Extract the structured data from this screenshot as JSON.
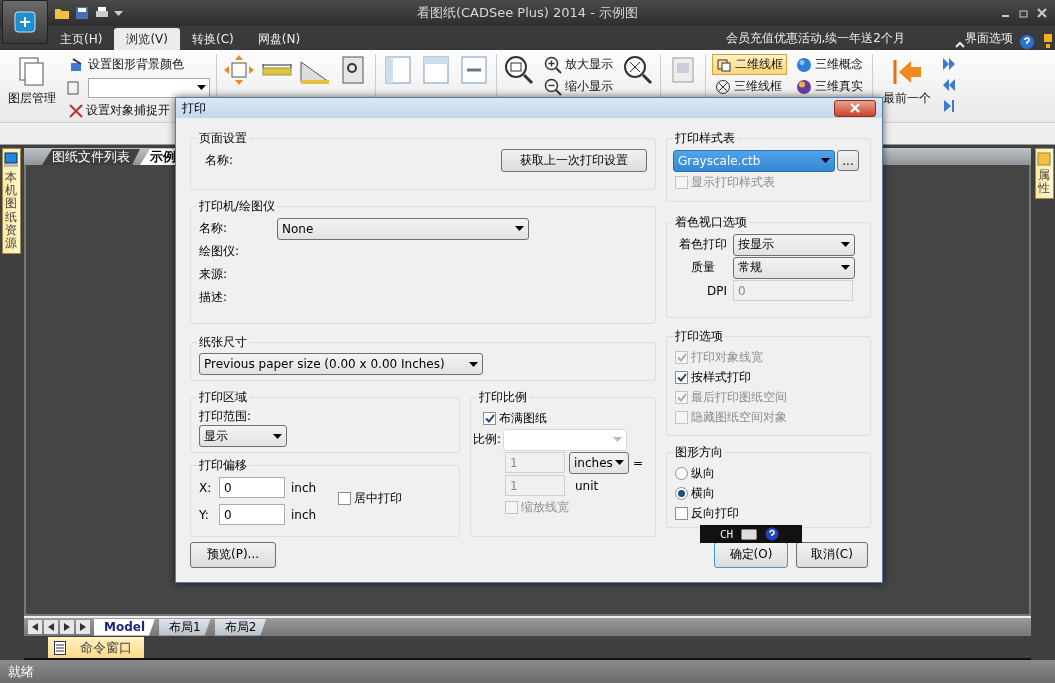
{
  "window": {
    "title": "看图纸(CADSee Plus) 2014 - 示例图"
  },
  "menu_tabs": [
    {
      "label": "主页(H)",
      "selected": false
    },
    {
      "label": "浏览(V)",
      "selected": true
    },
    {
      "label": "转换(C)",
      "selected": false
    },
    {
      "label": "网盘(N)",
      "selected": false
    }
  ],
  "promo": "会员充值优惠活动,续一年送2个月",
  "interface_options": "界面选项",
  "ribbon": {
    "layer_manager": "图层管理",
    "background_color": "设置图形背景颜色",
    "snap_toggle": "设置对象捕捉开",
    "zoom_in": "放大显示",
    "zoom_out": "缩小显示",
    "first": "最前一个",
    "visual_styles": [
      {
        "label": "二维线框",
        "kind": "wire2d",
        "selected": true
      },
      {
        "label": "三维线框",
        "kind": "wire3d",
        "selected": false
      },
      {
        "label": "三维概念",
        "kind": "concept",
        "selected": false
      },
      {
        "label": "三维真实",
        "kind": "real",
        "selected": false
      }
    ]
  },
  "left_panel_tab": "本机图纸资源",
  "right_panel_tab": "属性",
  "doc_tabs": [
    {
      "label": "图纸文件列表",
      "selected": false
    },
    {
      "label": "示例",
      "selected": true
    }
  ],
  "layout_tabs": [
    {
      "label": "Model",
      "selected": true
    },
    {
      "label": "布局1",
      "selected": false
    },
    {
      "label": "布局2",
      "selected": false
    }
  ],
  "command_window": "命令窗口",
  "status": "就绪",
  "ime": "CH",
  "dialog": {
    "title": "打印",
    "page_setup": {
      "title": "页面设置",
      "name_label": "名称:",
      "fetch_button": "获取上一次打印设置"
    },
    "printer": {
      "title": "打印机/绘图仪",
      "name_label": "名称:",
      "name_value": "None",
      "rows": [
        "绘图仪:",
        "来源:",
        "描述:"
      ]
    },
    "paper_size": {
      "title": "纸张尺寸",
      "value": "Previous paper size (0.00 x 0.00 Inches)"
    },
    "print_area": {
      "title": "打印区域",
      "range_label": "打印范围:",
      "range_value": "显示"
    },
    "offset": {
      "title": "打印偏移",
      "x_label": "X:",
      "x_value": "0",
      "x_unit": "inch",
      "y_label": "Y:",
      "y_value": "0",
      "y_unit": "inch",
      "center": {
        "label": "居中打印",
        "checked": false,
        "disabled": false
      }
    },
    "scale": {
      "title": "打印比例",
      "fit": {
        "label": "布满图纸",
        "checked": true,
        "disabled": false
      },
      "scale_label": "比例:",
      "value1": "1",
      "unit_select": "inches",
      "equals": "=",
      "value2": "1",
      "unit2": "unit",
      "lineweight": {
        "label": "缩放线宽",
        "checked": false,
        "disabled": true
      }
    },
    "plot_style": {
      "title": "打印样式表",
      "value": "Grayscale.ctb",
      "browse": "...",
      "show": {
        "label": "显示打印样式表",
        "checked": false,
        "disabled": true
      }
    },
    "shaded": {
      "title": "着色视口选项",
      "shade_label": "着色打印",
      "shade_value": "按显示",
      "quality_label": "质量",
      "quality_value": "常规",
      "dpi_label": "DPI",
      "dpi_value": "0"
    },
    "options": {
      "title": "打印选项",
      "items": [
        {
          "label": "打印对象线宽",
          "checked": true,
          "disabled": true
        },
        {
          "label": "按样式打印",
          "checked": true,
          "disabled": false
        },
        {
          "label": "最后打印图纸空间",
          "checked": true,
          "disabled": true
        },
        {
          "label": "隐藏图纸空间对象",
          "checked": false,
          "disabled": true
        }
      ]
    },
    "orientation": {
      "title": "图形方向",
      "radios": [
        {
          "label": "纵向",
          "selected": false
        },
        {
          "label": "横向",
          "selected": true
        }
      ],
      "reverse": {
        "label": "反向打印",
        "checked": false,
        "disabled": false
      }
    },
    "preview_button": "预览(P)...",
    "ok_button": "确定(O)",
    "cancel_button": "取消(C)"
  }
}
